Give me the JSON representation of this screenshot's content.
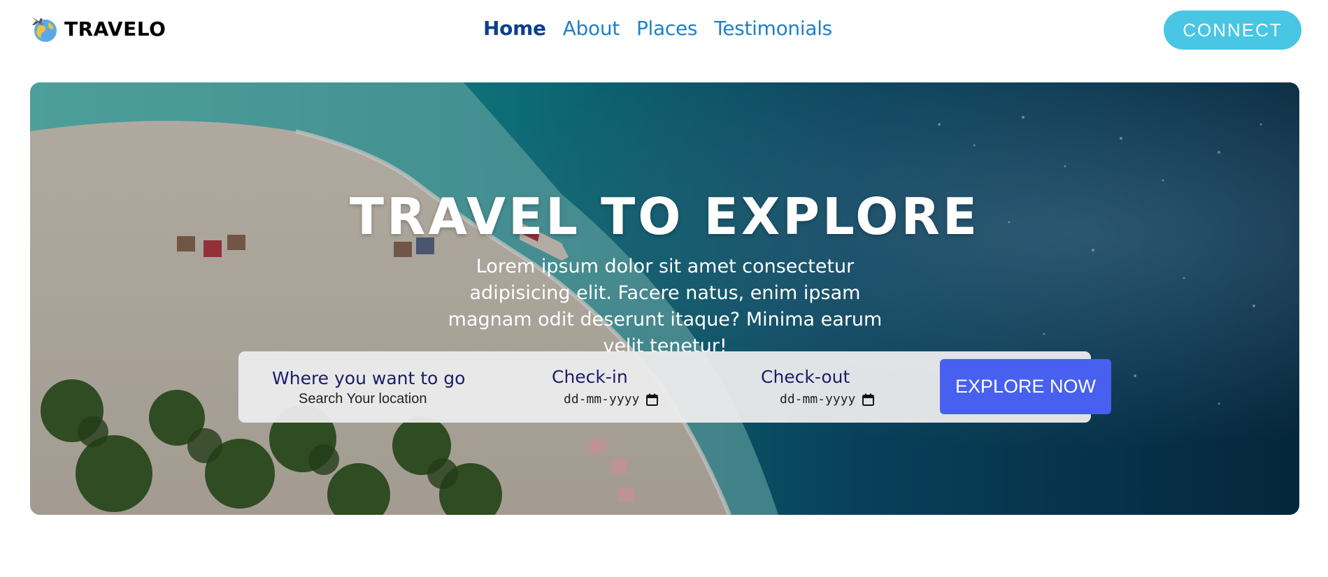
{
  "brand": {
    "name": "TRAVELO",
    "icon": "globe-plane-icon"
  },
  "nav": {
    "links": [
      {
        "label": "Home",
        "active": true
      },
      {
        "label": "About",
        "active": false
      },
      {
        "label": "Places",
        "active": false
      },
      {
        "label": "Testimonials",
        "active": false
      }
    ],
    "connect_label": "CONNECT"
  },
  "hero": {
    "title": "TRAVEL TO EXPLORE",
    "subtitle": "Lorem ipsum dolor sit amet consectetur adipisicing elit. Facere natus, enim ipsam magnam odit deserunt itaque? Minima earum velit tenetur!",
    "background": "aerial-beach-photo"
  },
  "search": {
    "destination_label": "Where you want to go",
    "destination_placeholder": "Search Your location",
    "checkin_label": "Check-in",
    "checkin_value": "dd-mm-yyyy",
    "checkout_label": "Check-out",
    "checkout_value": "dd-mm-yyyy",
    "button_label": "EXPLORE NOW"
  },
  "colors": {
    "connect": "#48c6e3",
    "explore_button": "#4760ef",
    "nav_active": "#0d3f8f",
    "nav_link": "#1f80c8",
    "field_label": "#1c1c6b"
  }
}
